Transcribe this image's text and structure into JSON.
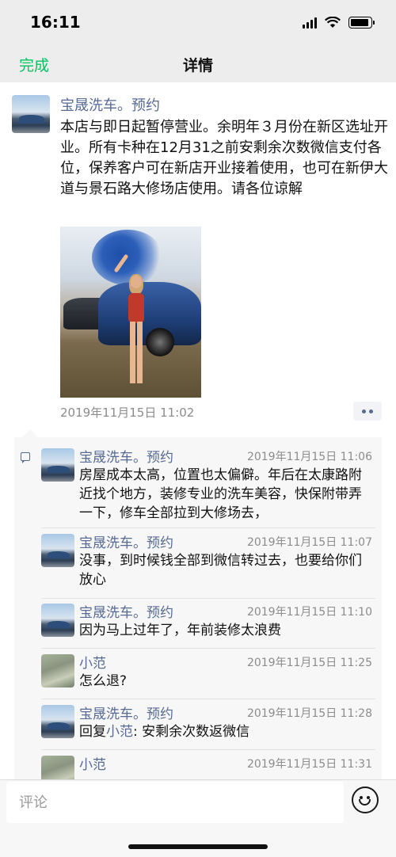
{
  "status_bar": {
    "time": "16:11",
    "battery_level": 0.9
  },
  "nav": {
    "back_label": "完成",
    "title": "详情"
  },
  "post": {
    "author": "宝晟洗车。预约",
    "text": "本店与即日起暂停营业。余明年３月份在新区选址开业。所有卡种在12月31之前安剩余次数微信支付各位，保养客户可在新店开业接着使用，也可在新伊大道与景石路大修场店使用。请各位谅解",
    "time": "2019年11月15日 11:02"
  },
  "comments": [
    {
      "author": "宝晟洗车。预约",
      "time": "2019年11月15日 11:06",
      "text": "房屋成本太高，位置也太偏僻。年后在太康路附近找个地方，装修专业的洗车美容，快保附带弄一下，修车全部拉到大修场去，",
      "avatar": "car"
    },
    {
      "author": "宝晟洗车。预约",
      "time": "2019年11月15日 11:07",
      "text": "没事，到时候钱全部到微信转过去，也要给你们放心",
      "avatar": "car"
    },
    {
      "author": "宝晟洗车。预约",
      "time": "2019年11月15日 11:10",
      "text": "因为马上过年了，年前装修太浪费",
      "avatar": "car"
    },
    {
      "author": "小范",
      "time": "2019年11月15日 11:25",
      "text": "怎么退?",
      "avatar": "rock"
    },
    {
      "author": "宝晟洗车。预约",
      "time": "2019年11月15日 11:28",
      "reply_prefix": "回复",
      "reply_to": "小范",
      "text": ": 安剩余次数返微信",
      "avatar": "car"
    },
    {
      "author": "小范",
      "time": "2019年11月15日 11:31",
      "text": "",
      "avatar": "rock"
    }
  ],
  "input": {
    "placeholder": "评论"
  },
  "colors": {
    "accent_green": "#07c160",
    "link_blue": "#576b95"
  }
}
